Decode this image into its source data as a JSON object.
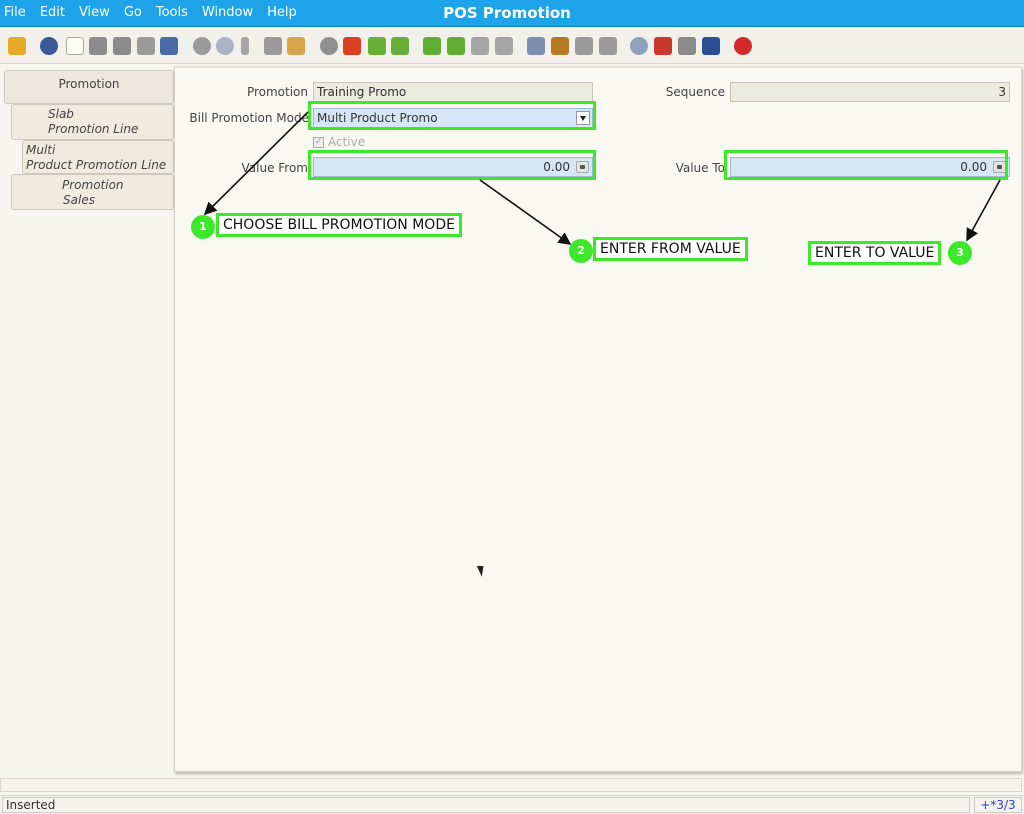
{
  "window": {
    "title": "POS Promotion"
  },
  "menu": [
    {
      "label": "File",
      "name": "menu-file"
    },
    {
      "label": "Edit",
      "name": "menu-edit"
    },
    {
      "label": "View",
      "name": "menu-view"
    },
    {
      "label": "Go",
      "name": "menu-go"
    },
    {
      "label": "Tools",
      "name": "menu-tools"
    },
    {
      "label": "Window",
      "name": "menu-window"
    },
    {
      "label": "Help",
      "name": "menu-help"
    }
  ],
  "toolbar_icons": [
    "undo-icon",
    "help-icon",
    "new-record-icon",
    "copy-record-icon",
    "delete-icon",
    "delete-selection-icon",
    "save-icon",
    "refresh-icon",
    "find-icon",
    "attachment-icon",
    "chat-icon",
    "grid-toggle-icon",
    "history-icon",
    "home-icon",
    "back-icon",
    "forward-icon",
    "first-record-icon",
    "previous-record-icon",
    "next-record-icon",
    "last-record-icon",
    "report-icon",
    "archive-icon",
    "print-preview-icon",
    "print-icon",
    "zoom-across-icon",
    "workflow-icon",
    "request-icon",
    "product-info-icon",
    "close-window-icon"
  ],
  "tabs": [
    {
      "label": "Promotion",
      "name": "tab-promotion"
    },
    {
      "label_1": "Slab",
      "label_2": "Promotion Line",
      "name": "tab-slab-promotion-line"
    },
    {
      "label_1": "Multi",
      "label_2": "Product Promotion Line",
      "name": "tab-multi-product-promotion-line"
    },
    {
      "label_1": "Promotion",
      "label_2": "Sales",
      "name": "tab-promotion-sales"
    }
  ],
  "form": {
    "promotion_label": "Promotion",
    "promotion_value": "Training Promo",
    "sequence_label": "Sequence",
    "sequence_value": "3",
    "mode_label": "Bill Promotion Mode",
    "mode_value": "Multi Product Promo",
    "active_label": "Active",
    "active_checked": true,
    "value_from_label": "Value From",
    "value_from": "0.00",
    "value_to_label": "Value To",
    "value_to": "0.00"
  },
  "annotations": [
    {
      "number": "1",
      "text": "CHOOSE BILL PROMOTION MODE"
    },
    {
      "number": "2",
      "text": "ENTER FROM VALUE"
    },
    {
      "number": "3",
      "text": "ENTER TO VALUE"
    }
  ],
  "colors": {
    "highlight": "#3de82a",
    "titlebar": "#1da3ea"
  },
  "status": {
    "message": "Inserted",
    "record": "+*3/3"
  }
}
